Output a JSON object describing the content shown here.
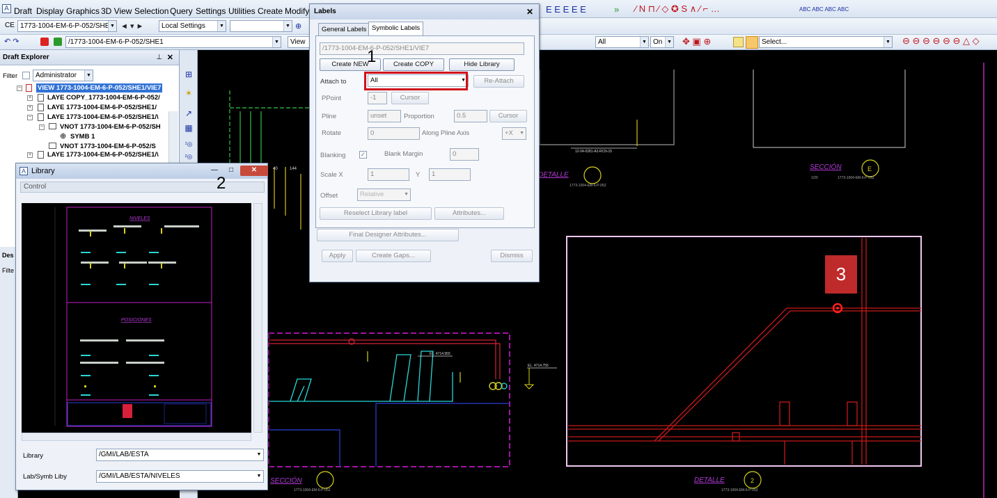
{
  "menubar": {
    "items": [
      "Draft",
      "Display",
      "Graphics",
      "3D View",
      "Selection",
      "Query",
      "Settings",
      "Utilities",
      "Create",
      "Modify"
    ]
  },
  "toolbar": {
    "ce_label": "CE",
    "ce_value": "1773-1004-EM-6-P-052/SHE1",
    "settings_value": "Local Settings",
    "path_value": "/1773-1004-EM-6-P-052/SHE1",
    "view_label": "View",
    "filter_all": "All",
    "filter_on": "On",
    "select_value": "Select..."
  },
  "explorer": {
    "title": "Draft Explorer",
    "filter_label": "Filter",
    "filter_value": "Administrator",
    "rows": [
      "VIEW 1773-1004-EM-6-P-052/SHE1/VIE7",
      "LAYE COPY_1773-1004-EM-6-P-052/",
      "LAYE 1773-1004-EM-6-P-052/SHE1/",
      "LAYE 1773-1004-EM-6-P-052/SHE1/\\",
      "VNOT 1773-1004-EM-6-P-052/SH",
      "SYMB 1",
      "VNOT 1773-1004-EM-6-P-052/S",
      "LAYE 1773-1004-EM-6-P-052/SHE1/\\"
    ],
    "lower_title": "Des",
    "lower_filter": "Filte"
  },
  "labels_dialog": {
    "title": "Labels",
    "tabs": [
      "General Labels",
      "Symbolic Labels"
    ],
    "path": "/1773-1004-EM-6-P-052/SHE1/VIE7",
    "create_new": "Create NEW",
    "create_copy": "Create COPY",
    "hide_library": "Hide Library",
    "attach_to_label": "Attach to",
    "attach_to_value": "All",
    "reattach": "Re-Attach",
    "ppoint_label": "PPoint",
    "ppoint_value": "-1",
    "cursor": "Cursor",
    "pline_label": "Pline",
    "pline_value": "unset",
    "proportion_label": "Proportion",
    "proportion_value": "0.5",
    "rotate_label": "Rotate",
    "rotate_value": "0",
    "along_pline": "Along Pline Axis",
    "along_value": "+X",
    "blanking_label": "Blanking",
    "blank_margin_label": "Blank Margin",
    "blank_margin_value": "0",
    "scale_label": "Scale  X",
    "scale_x": "1",
    "y_label": "Y",
    "scale_y": "1",
    "offset_label": "Offset",
    "offset_value": "Relative",
    "reselect": "Reselect Library label",
    "attributes": "Attributes...",
    "final_designer": "Final Designer Attributes...",
    "apply": "Apply",
    "create_gaps": "Create Gaps...",
    "dismiss": "Dismiss"
  },
  "library_dialog": {
    "title": "Library",
    "section": "Control",
    "library_label": "Library",
    "library_value": "/GMI/LAB/ESTA",
    "labsymb_label": "Lab/Symb  Liby",
    "labsymb_value": "/GMI/LAB/ESTA/NIVELES",
    "preview_niveles": "NIVELES",
    "preview_posiciones": "POSICIONES"
  },
  "annotations": {
    "one": "1",
    "two": "2",
    "three": "3"
  },
  "cad": {
    "seccion": "SECCIÓN",
    "detalle": "DETALLE",
    "sheet_ref": "1773-1004-EM-6-P-052",
    "level_1": "EL. 4714.955",
    "level_2": "EL. 4714.755",
    "pipe_ref": "12-04-0281-A2-RCN-15",
    "label_1": "1/20",
    "circle_e": "E",
    "circle_2": "2",
    "dim_1": "40",
    "dim_2": "144"
  },
  "colors": {
    "cad_bg": "#000000",
    "highlight_red": "#d1121a",
    "badge_red": "#bf2a2a",
    "magenta": "#d81bd8",
    "selection_blue": "#3173d6"
  }
}
